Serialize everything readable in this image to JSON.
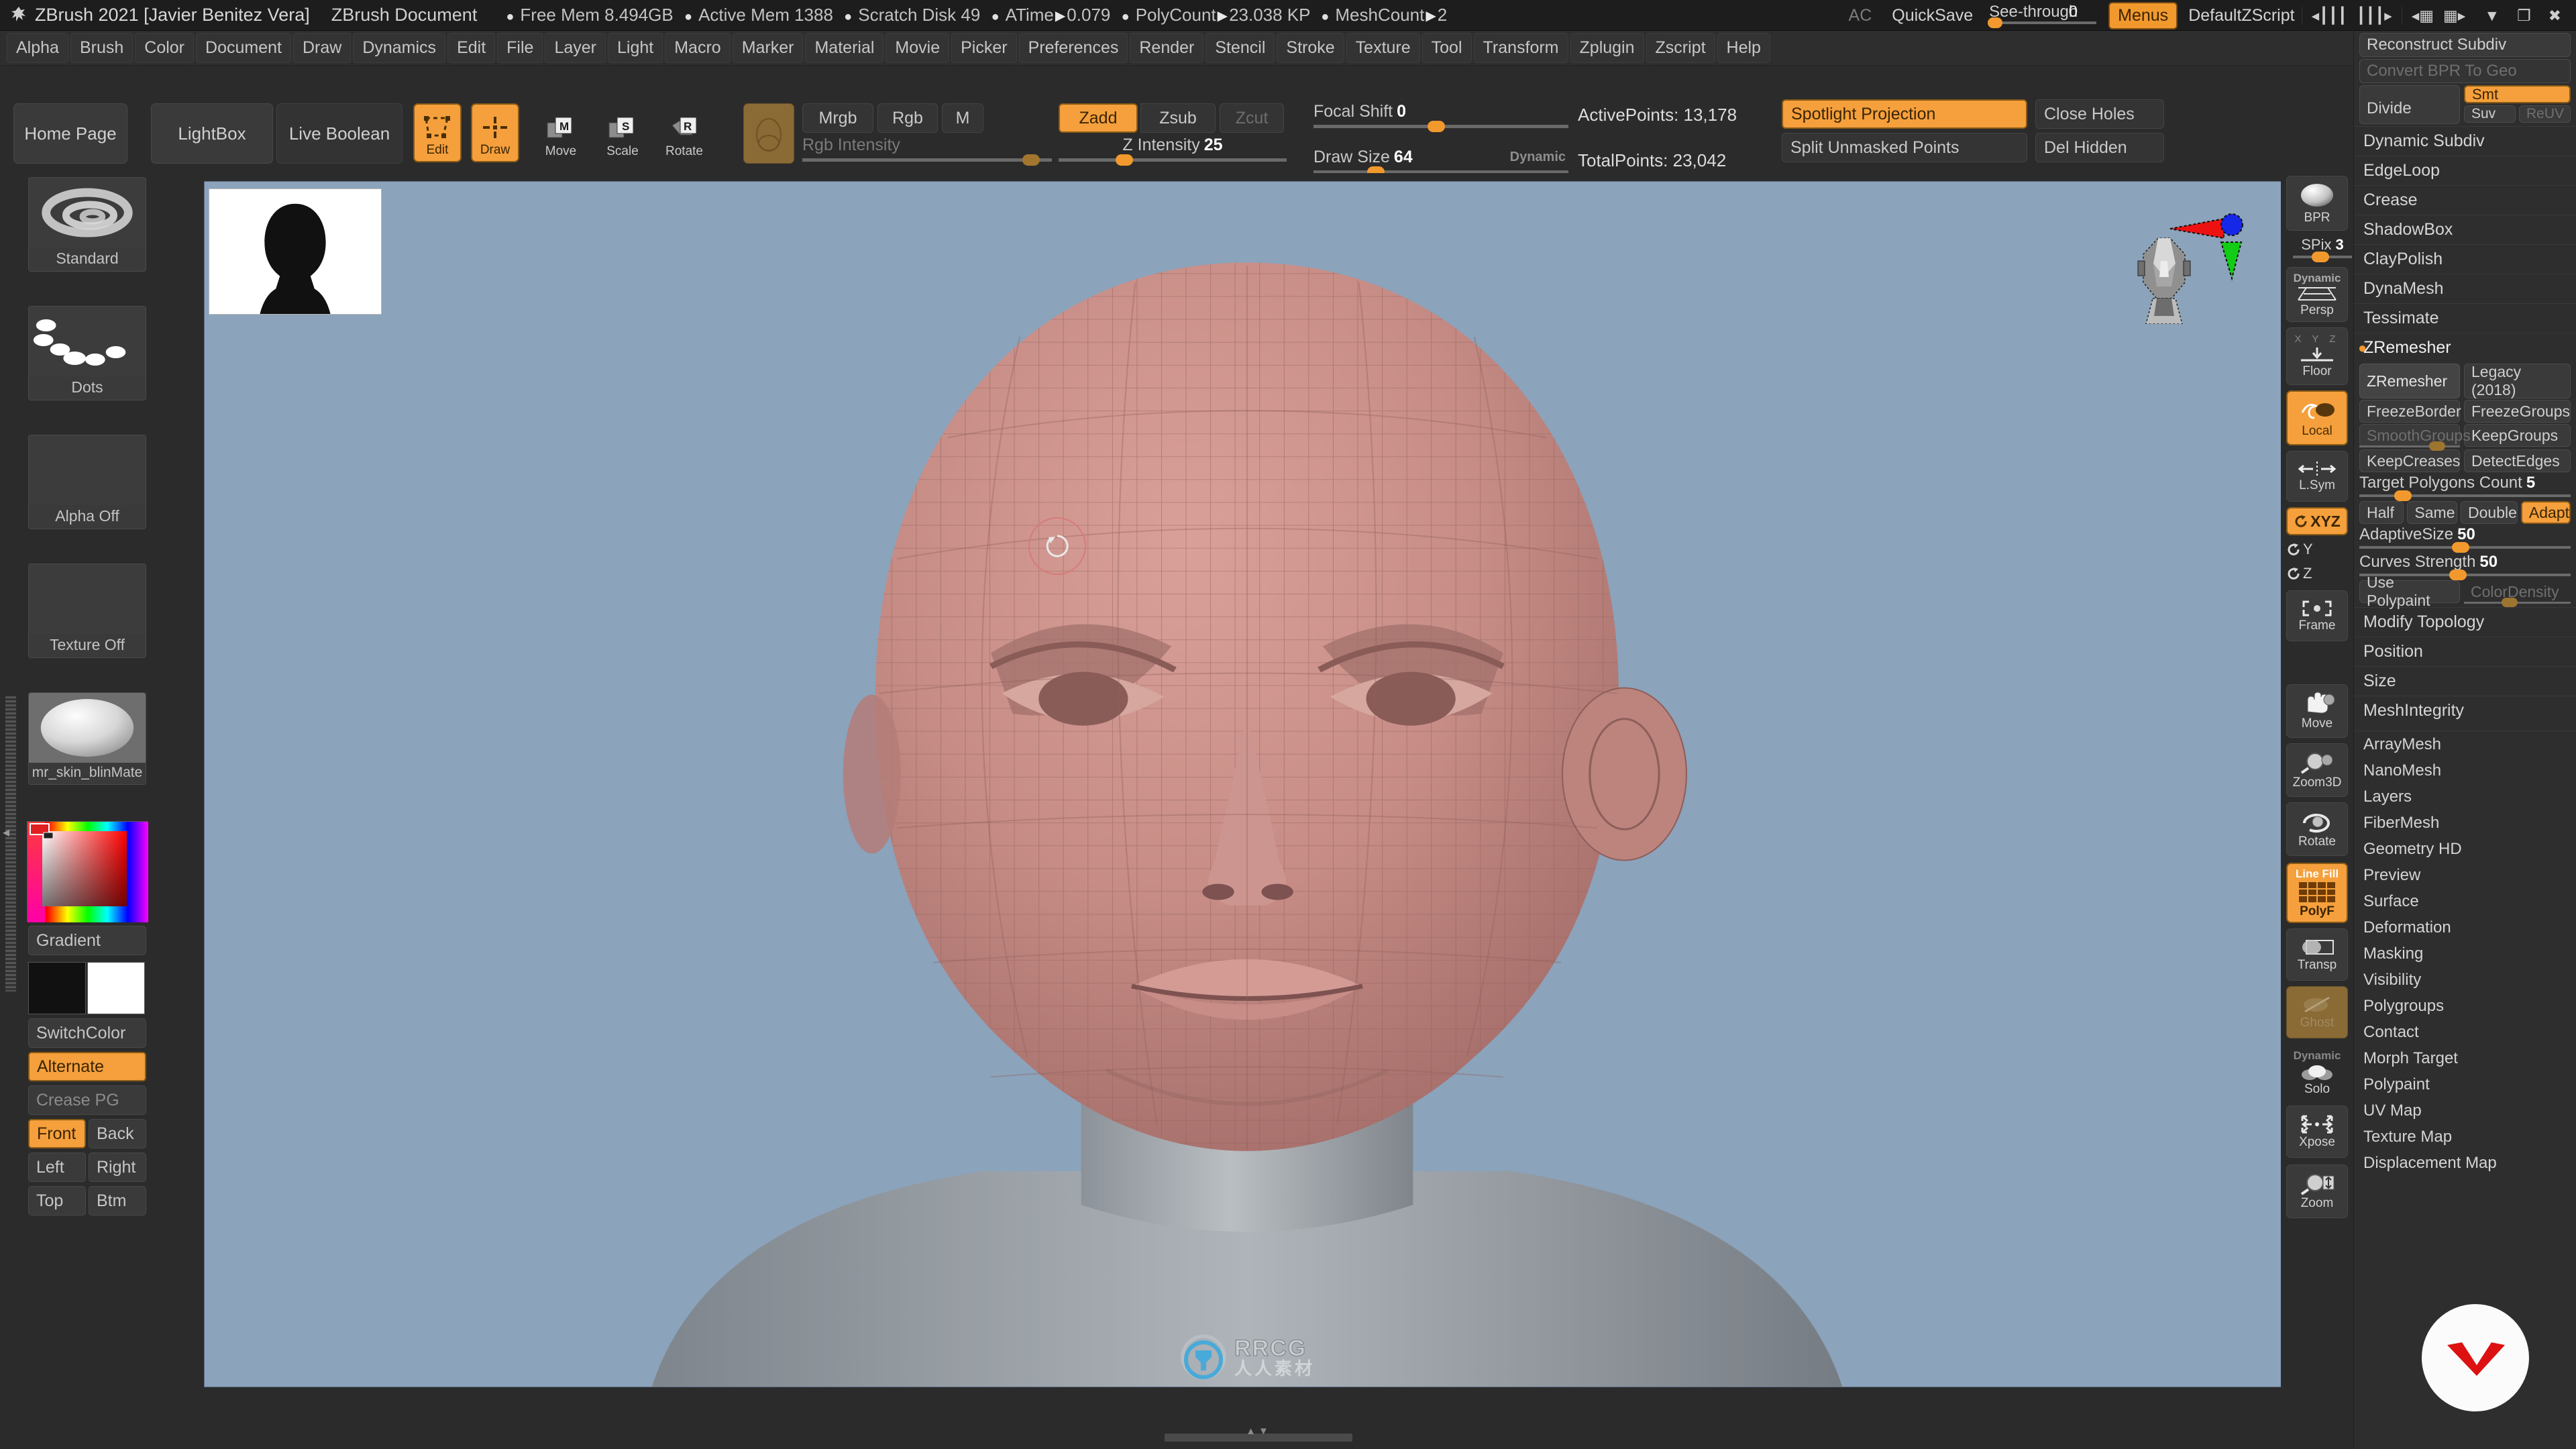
{
  "titlebar": {
    "app_title": "ZBrush 2021 [Javier Benitez Vera]",
    "document": "ZBrush Document",
    "stat_free_mem": "Free Mem 8.494GB",
    "stat_active_mem": "Active Mem 1388",
    "stat_scratch_disk": "Scratch Disk 49",
    "stat_atime_label": "ATime",
    "stat_atime_value": "0.079",
    "stat_polycount_label": "PolyCount",
    "stat_polycount_value": "23.038 KP",
    "stat_meshcount_label": "MeshCount",
    "stat_meshcount_value": "2",
    "ac": "AC",
    "quicksave": "QuickSave",
    "seethrough_label": "See-through",
    "seethrough_value": "0",
    "menus": "Menus",
    "zscript": "DefaultZScript"
  },
  "menubar": {
    "items": [
      "Alpha",
      "Brush",
      "Color",
      "Document",
      "Draw",
      "Dynamics",
      "Edit",
      "File",
      "Layer",
      "Light",
      "Macro",
      "Marker",
      "Material",
      "Movie",
      "Picker",
      "Preferences",
      "Render",
      "Stencil",
      "Stroke",
      "Texture",
      "Tool",
      "Transform",
      "Zplugin",
      "Zscript",
      "Help"
    ]
  },
  "topshelf": {
    "home_page": "Home Page",
    "lightbox": "LightBox",
    "live_boolean": "Live Boolean",
    "modes": [
      {
        "label": "Edit",
        "active": true
      },
      {
        "label": "Draw",
        "active": true
      },
      {
        "label": "Move",
        "active": false
      },
      {
        "label": "Scale",
        "active": false
      },
      {
        "label": "Rotate",
        "active": false
      }
    ],
    "mrgb": "Mrgb",
    "rgb": "Rgb",
    "m": "M",
    "rgb_intensity_label": "Rgb Intensity",
    "rgb_intensity_value": "",
    "zadd": "Zadd",
    "zsub": "Zsub",
    "zcut": "Zcut",
    "z_intensity_label": "Z Intensity",
    "z_intensity_value": "25",
    "focal_shift_label": "Focal Shift",
    "focal_shift_value": "0",
    "draw_size_label": "Draw Size",
    "draw_size_value": "64",
    "dynamic": "Dynamic",
    "active_points": "ActivePoints: 13,178",
    "total_points": "TotalPoints: 23,042",
    "spotlight_projection": "Spotlight Projection",
    "close_holes": "Close Holes",
    "split_unmasked_points": "Split Unmasked Points",
    "del_hidden": "Del Hidden"
  },
  "leftshelf": {
    "brush_label": "Standard",
    "stroke_label": "Dots",
    "alpha_label": "Alpha Off",
    "texture_label": "Texture Off",
    "material_label": "mr_skin_blinMate",
    "gradient": "Gradient",
    "switch_color": "SwitchColor",
    "alternate": "Alternate",
    "crease_pg": "Crease PG",
    "front": "Front",
    "back": "Back",
    "left": "Left",
    "right": "Right",
    "top": "Top",
    "btm": "Btm"
  },
  "rightshelf": {
    "items": [
      {
        "label": "BPR",
        "state": "normal"
      },
      {
        "label": "Persp",
        "sublabel": "Dynamic",
        "state": "normal"
      },
      {
        "label": "Floor",
        "state": "normal"
      },
      {
        "label": "Local",
        "state": "active"
      },
      {
        "label": "L.Sym",
        "state": "normal"
      },
      {
        "label": "XYZ",
        "state": "active"
      },
      {
        "label": "Y",
        "state": "plain"
      },
      {
        "label": "Z",
        "state": "plain"
      },
      {
        "label": "Frame",
        "state": "normal"
      },
      {
        "label": "Move",
        "state": "normal"
      },
      {
        "label": "Zoom3D",
        "state": "normal"
      },
      {
        "label": "Rotate",
        "state": "normal"
      },
      {
        "label": "PolyF",
        "sublabel": "Line Fill",
        "state": "active"
      },
      {
        "label": "Transp",
        "state": "normal"
      },
      {
        "label": "Ghost",
        "state": "semi"
      },
      {
        "label": "Solo",
        "sublabel": "Dynamic",
        "state": "normal"
      },
      {
        "label": "Xpose",
        "state": "normal"
      },
      {
        "label": "Zoom",
        "state": "normal"
      }
    ],
    "spix_label": "SPix",
    "spix_value": "3"
  },
  "rightpanel": {
    "reconstruct_subdiv": "Reconstruct Subdiv",
    "convert_bpr_to_geo": "Convert BPR To Geo",
    "divide": "Divide",
    "smt": "Smt",
    "suv": "Suv",
    "reuv": "ReUV",
    "sections": [
      "Dynamic Subdiv",
      "EdgeLoop",
      "Crease",
      "ShadowBox",
      "ClayPolish",
      "DynaMesh",
      "Tessimate"
    ],
    "zremesher_header": "ZRemesher",
    "zremesher_button": "ZRemesher",
    "legacy": "Legacy (2018)",
    "freeze_border": "FreezeBorder",
    "freeze_groups": "FreezeGroups",
    "smooth_groups": "SmoothGroups",
    "keep_groups": "KeepGroups",
    "keep_creases": "KeepCreases",
    "detect_edges": "DetectEdges",
    "target_polygons_label": "Target Polygons Count",
    "target_polygons_value": "5",
    "half": "Half",
    "same": "Same",
    "double": "Double",
    "adapt": "Adapt",
    "adaptive_size_label": "AdaptiveSize",
    "adaptive_size_value": "50",
    "curves_strength_label": "Curves Strength",
    "curves_strength_value": "50",
    "use_polypaint": "Use Polypaint",
    "color_density": "ColorDensity",
    "sections2": [
      "Modify Topology",
      "Position",
      "Size",
      "MeshIntegrity"
    ],
    "list": [
      "ArrayMesh",
      "NanoMesh",
      "Layers",
      "FiberMesh",
      "Geometry HD",
      "Preview",
      "Surface",
      "Deformation",
      "Masking",
      "Visibility",
      "Polygroups",
      "Contact",
      "Morph Target",
      "Polypaint",
      "UV Map",
      "Texture Map",
      "Displacement Map"
    ]
  },
  "watermark": {
    "brand": "RRCG",
    "sub": "人人素材"
  },
  "colors": {
    "accent": "#f5a03c",
    "panel_bg": "#2b2b2b",
    "canvas_bg": "#8ba3bb",
    "model": "#c08b85",
    "title_bg": "#1d1d1d"
  }
}
